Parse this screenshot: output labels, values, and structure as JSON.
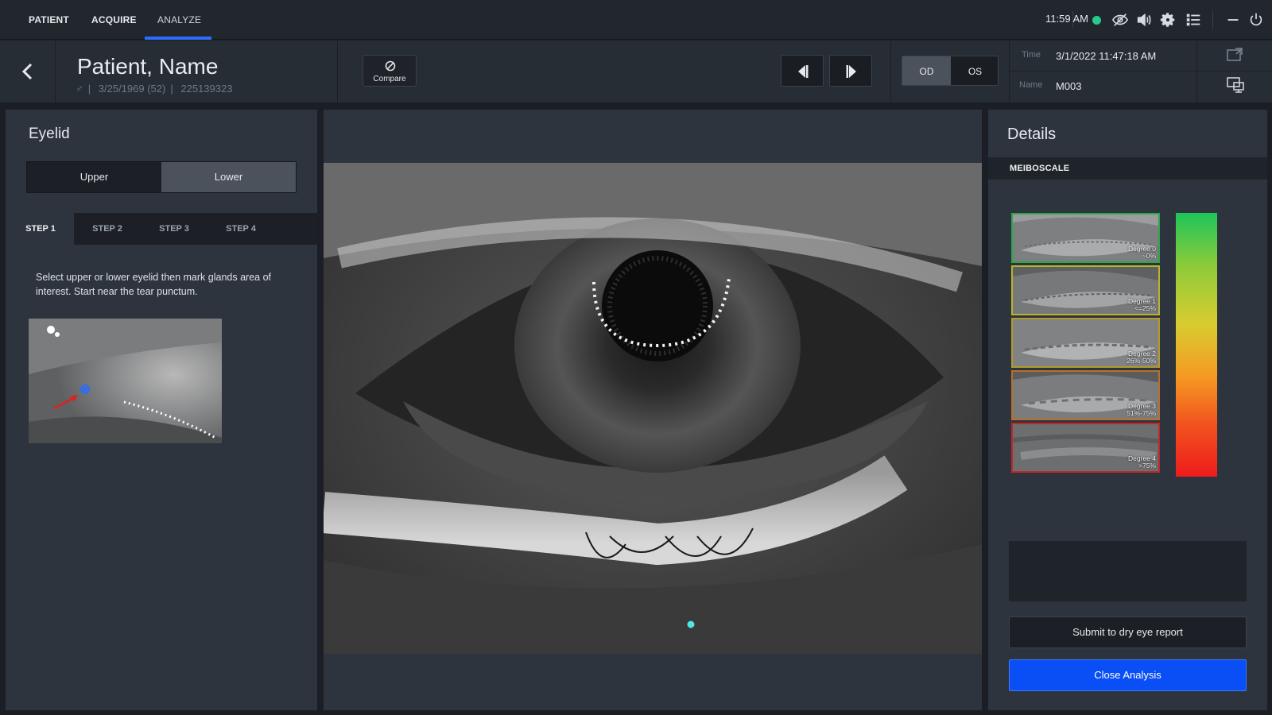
{
  "nav": {
    "tabs": [
      {
        "label": "PATIENT"
      },
      {
        "label": "ACQUIRE"
      },
      {
        "label": "ANALYZE",
        "active": true
      }
    ],
    "time": "11:59 AM",
    "status_color": "#28c98a"
  },
  "header": {
    "patient_name": "Patient, Name",
    "gender_symbol": "♂",
    "dob": "3/25/1969 (52)",
    "patient_id": "225139323",
    "compare_label": "Compare",
    "eye_toggle": {
      "od": "OD",
      "os": "OS",
      "selected": "OD"
    },
    "time_label": "Time",
    "time_value": "3/1/2022 11:47:18 AM",
    "name_label": "Name",
    "name_value": "M003"
  },
  "left_panel": {
    "title": "Eyelid",
    "segments": {
      "upper": "Upper",
      "lower": "Lower",
      "selected": "Lower"
    },
    "steps": [
      "STEP 1",
      "STEP 2",
      "STEP 3",
      "STEP 4"
    ],
    "active_step": "STEP 1",
    "instructions": "Select upper or lower eyelid then mark glands area of interest. Start near the tear punctum."
  },
  "right_panel": {
    "title": "Details",
    "section": "MEIBOSCALE",
    "degrees": [
      {
        "line1": "Degree 0",
        "line2": "~0%",
        "color": "#2aa84a"
      },
      {
        "line1": "Degree 1",
        "line2": "<=25%",
        "color": "#b6b52a"
      },
      {
        "line1": "Degree 2",
        "line2": "26%-50%",
        "color": "#b39a2a"
      },
      {
        "line1": "Degree 3",
        "line2": "51%-75%",
        "color": "#b8702a"
      },
      {
        "line1": "Degree 4",
        "line2": ">75%",
        "color": "#c0272a"
      }
    ],
    "submit_label": "Submit to dry eye report",
    "close_label": "Close Analysis",
    "accent_color": "#0a4ef5"
  }
}
